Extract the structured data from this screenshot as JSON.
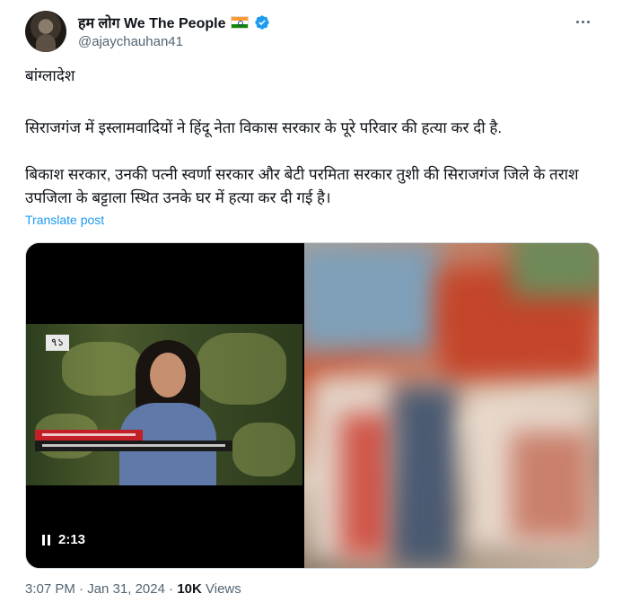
{
  "author": {
    "display_name": "हम लोग We The People",
    "handle": "@ajaychauhan41",
    "avatar_icon": "avatar-photo",
    "flag_icon": "india-flag-icon",
    "verified_icon": "verified-badge-icon",
    "verified_color": "#1d9bf0"
  },
  "tweet": {
    "paragraph_1": "बांग्लादेश",
    "paragraph_2": "सिराजगंज में इस्लामवादियों ने हिंदू नेता विकास सरकार के पूरे परिवार की हत्या कर दी है.",
    "paragraph_3": "बिकाश सरकार, उनकी पत्नी स्वर्णा सरकार और बेटी परमिता सरकार तुशी की सिराजगंज जिले के तराश उपजिला के बट्टाला स्थित उनके घर में हत्या कर दी गई है।",
    "translate_label": "Translate post"
  },
  "media": {
    "video": {
      "duration": "2:13",
      "channel_logo": "৭১"
    }
  },
  "meta": {
    "time": "3:07 PM",
    "date": "Jan 31, 2024",
    "separator": "·",
    "views_count": "10K",
    "views_label": "Views"
  },
  "colors": {
    "link": "#1d9bf0",
    "secondary_text": "#536471",
    "primary_text": "#0f1419"
  }
}
